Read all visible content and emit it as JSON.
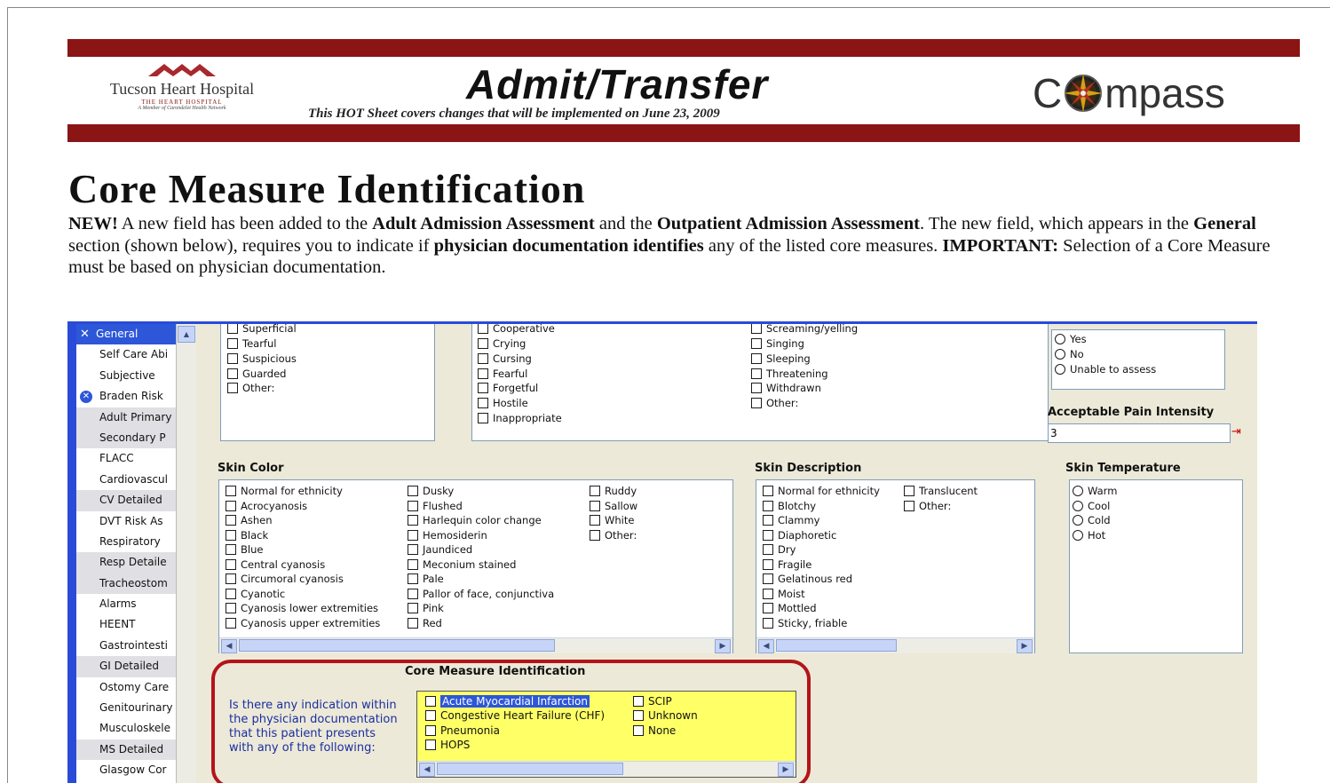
{
  "header": {
    "hospital_name": "Tucson Heart Hospital",
    "hospital_sub1": "THE HEART HOSPITAL",
    "hospital_sub2": "A Member of Carondelet Health Network",
    "title": "Admit/Transfer",
    "subtitle": "This HOT Sheet covers changes that will be implemented on June 23, 2009",
    "compass_logo": "Compass"
  },
  "colors": {
    "band": "#8b1414",
    "accent_blue": "#2a4bd7",
    "core_frame": "#b3141a",
    "core_panel": "#ffff66"
  },
  "page_title": "Core Measure Identification",
  "intro": {
    "new_label": "NEW!",
    "text1": " A new field has been added to the ",
    "bold1": "Adult Admission Assessment",
    "text2": " and the ",
    "bold2": "Outpatient Admission Assessment",
    "text3": ". The new field, which appears in the ",
    "bold3": "General",
    "text4": " section (shown below), requires you to indicate if ",
    "bold4": "physician documentation identifies",
    "text5": " any of the listed core measures. ",
    "important_label": "IMPORTANT:",
    "text6": "  Selection of a Core Measure must be based on physician documentation."
  },
  "sidebar": {
    "items": [
      {
        "label": "General",
        "icon": "close-icon"
      },
      {
        "label": "Self Care Abi"
      },
      {
        "label": "Subjective"
      },
      {
        "label": "Braden Risk",
        "icon": "braden-icon"
      },
      {
        "label": "Adult Primary"
      },
      {
        "label": "Secondary P"
      },
      {
        "label": "FLACC"
      },
      {
        "label": "Cardiovascul"
      },
      {
        "label": "CV Detailed"
      },
      {
        "label": "DVT Risk As"
      },
      {
        "label": "Respiratory"
      },
      {
        "label": "Resp Detaile"
      },
      {
        "label": "Tracheostom"
      },
      {
        "label": "Alarms"
      },
      {
        "label": "HEENT"
      },
      {
        "label": "Gastrointesti"
      },
      {
        "label": "GI Detailed"
      },
      {
        "label": "Ostomy Care"
      },
      {
        "label": "Genitourinary"
      },
      {
        "label": "Musculoskele"
      },
      {
        "label": "MS Detailed"
      },
      {
        "label": "Glasgow Cor"
      }
    ]
  },
  "behavior_col1": [
    "Superficial",
    "Tearful",
    "Suspicious",
    "Guarded",
    "Other:"
  ],
  "behavior_col2": [
    "Cooperative",
    "Crying",
    "Cursing",
    "Fearful",
    "Forgetful",
    "Hostile",
    "Inappropriate"
  ],
  "behavior_col3": [
    "Screaming/yelling",
    "Singing",
    "Sleeping",
    "Threatening",
    "Withdrawn",
    "Other:"
  ],
  "pain_options": [
    "Yes",
    "No",
    "Unable to assess"
  ],
  "pain_intensity": {
    "label": "Acceptable Pain Intensity",
    "value": "3"
  },
  "skin_color": {
    "label": "Skin Color",
    "col1": [
      "Normal for ethnicity",
      "Acrocyanosis",
      "Ashen",
      "Black",
      "Blue",
      "Central cyanosis",
      "Circumoral cyanosis",
      "Cyanotic",
      "Cyanosis lower extremities",
      "Cyanosis upper extremities"
    ],
    "col2": [
      "Dusky",
      "Flushed",
      "Harlequin color change",
      "Hemosiderin",
      "Jaundiced",
      "Meconium stained",
      "Pale",
      "Pallor of face, conjunctiva",
      "Pink",
      "Red"
    ],
    "col3": [
      "Ruddy",
      "Sallow",
      "White",
      "Other:"
    ]
  },
  "skin_description": {
    "label": "Skin Description",
    "col1": [
      "Normal for ethnicity",
      "Blotchy",
      "Clammy",
      "Diaphoretic",
      "Dry",
      "Fragile",
      "Gelatinous red",
      "Moist",
      "Mottled",
      "Sticky, friable"
    ],
    "col2": [
      "Translucent",
      "Other:"
    ]
  },
  "skin_temperature": {
    "label": "Skin Temperature",
    "options": [
      "Warm",
      "Cool",
      "Cold",
      "Hot"
    ]
  },
  "core_measure": {
    "label": "Core Measure Identification",
    "question": "Is there any indication within the physician documentation that this patient presents with any of the following:",
    "col1": [
      "Acute Myocardial Infarction",
      "Congestive Heart Failure (CHF)",
      "Pneumonia",
      "HOPS"
    ],
    "col2": [
      "SCIP",
      "Unknown",
      "None"
    ]
  }
}
